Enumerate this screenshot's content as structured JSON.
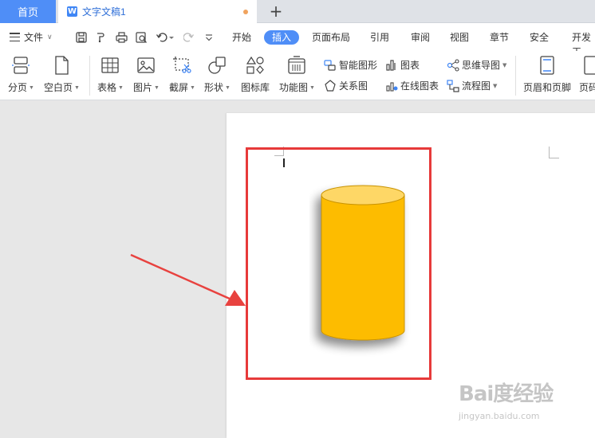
{
  "tabs": {
    "home_label": "首页",
    "doc_logo": "W",
    "doc_label": "文字文稿1",
    "new_tab_symbol": "+"
  },
  "menu": {
    "file_label": "文件",
    "tabs": [
      "开始",
      "插入",
      "页面布局",
      "引用",
      "审阅",
      "视图",
      "章节",
      "安全",
      "开发工"
    ],
    "active_tab": "插入"
  },
  "ribbon": {
    "page_break": "分页",
    "blank_page": "空白页",
    "table": "表格",
    "picture": "图片",
    "screenshot": "截屏",
    "shape": "形状",
    "icon_library": "图标库",
    "function_chart": "功能图",
    "smart_art": "智能图形",
    "chart": "图表",
    "mind_map": "思维导图",
    "relation_chart": "关系图",
    "online_chart": "在线图表",
    "flow_chart": "流程图",
    "header_footer": "页眉和页脚",
    "page_num_partial": "页码"
  },
  "colors": {
    "accent": "#4f8ef7",
    "highlight_box": "#e73a3a",
    "arrow": "#e8423f",
    "cylinder_body": "#fdbc00",
    "cylinder_top": "#fed766"
  },
  "watermark": {
    "brand": "Bai度经验",
    "url": "jingyan.baidu.com"
  }
}
